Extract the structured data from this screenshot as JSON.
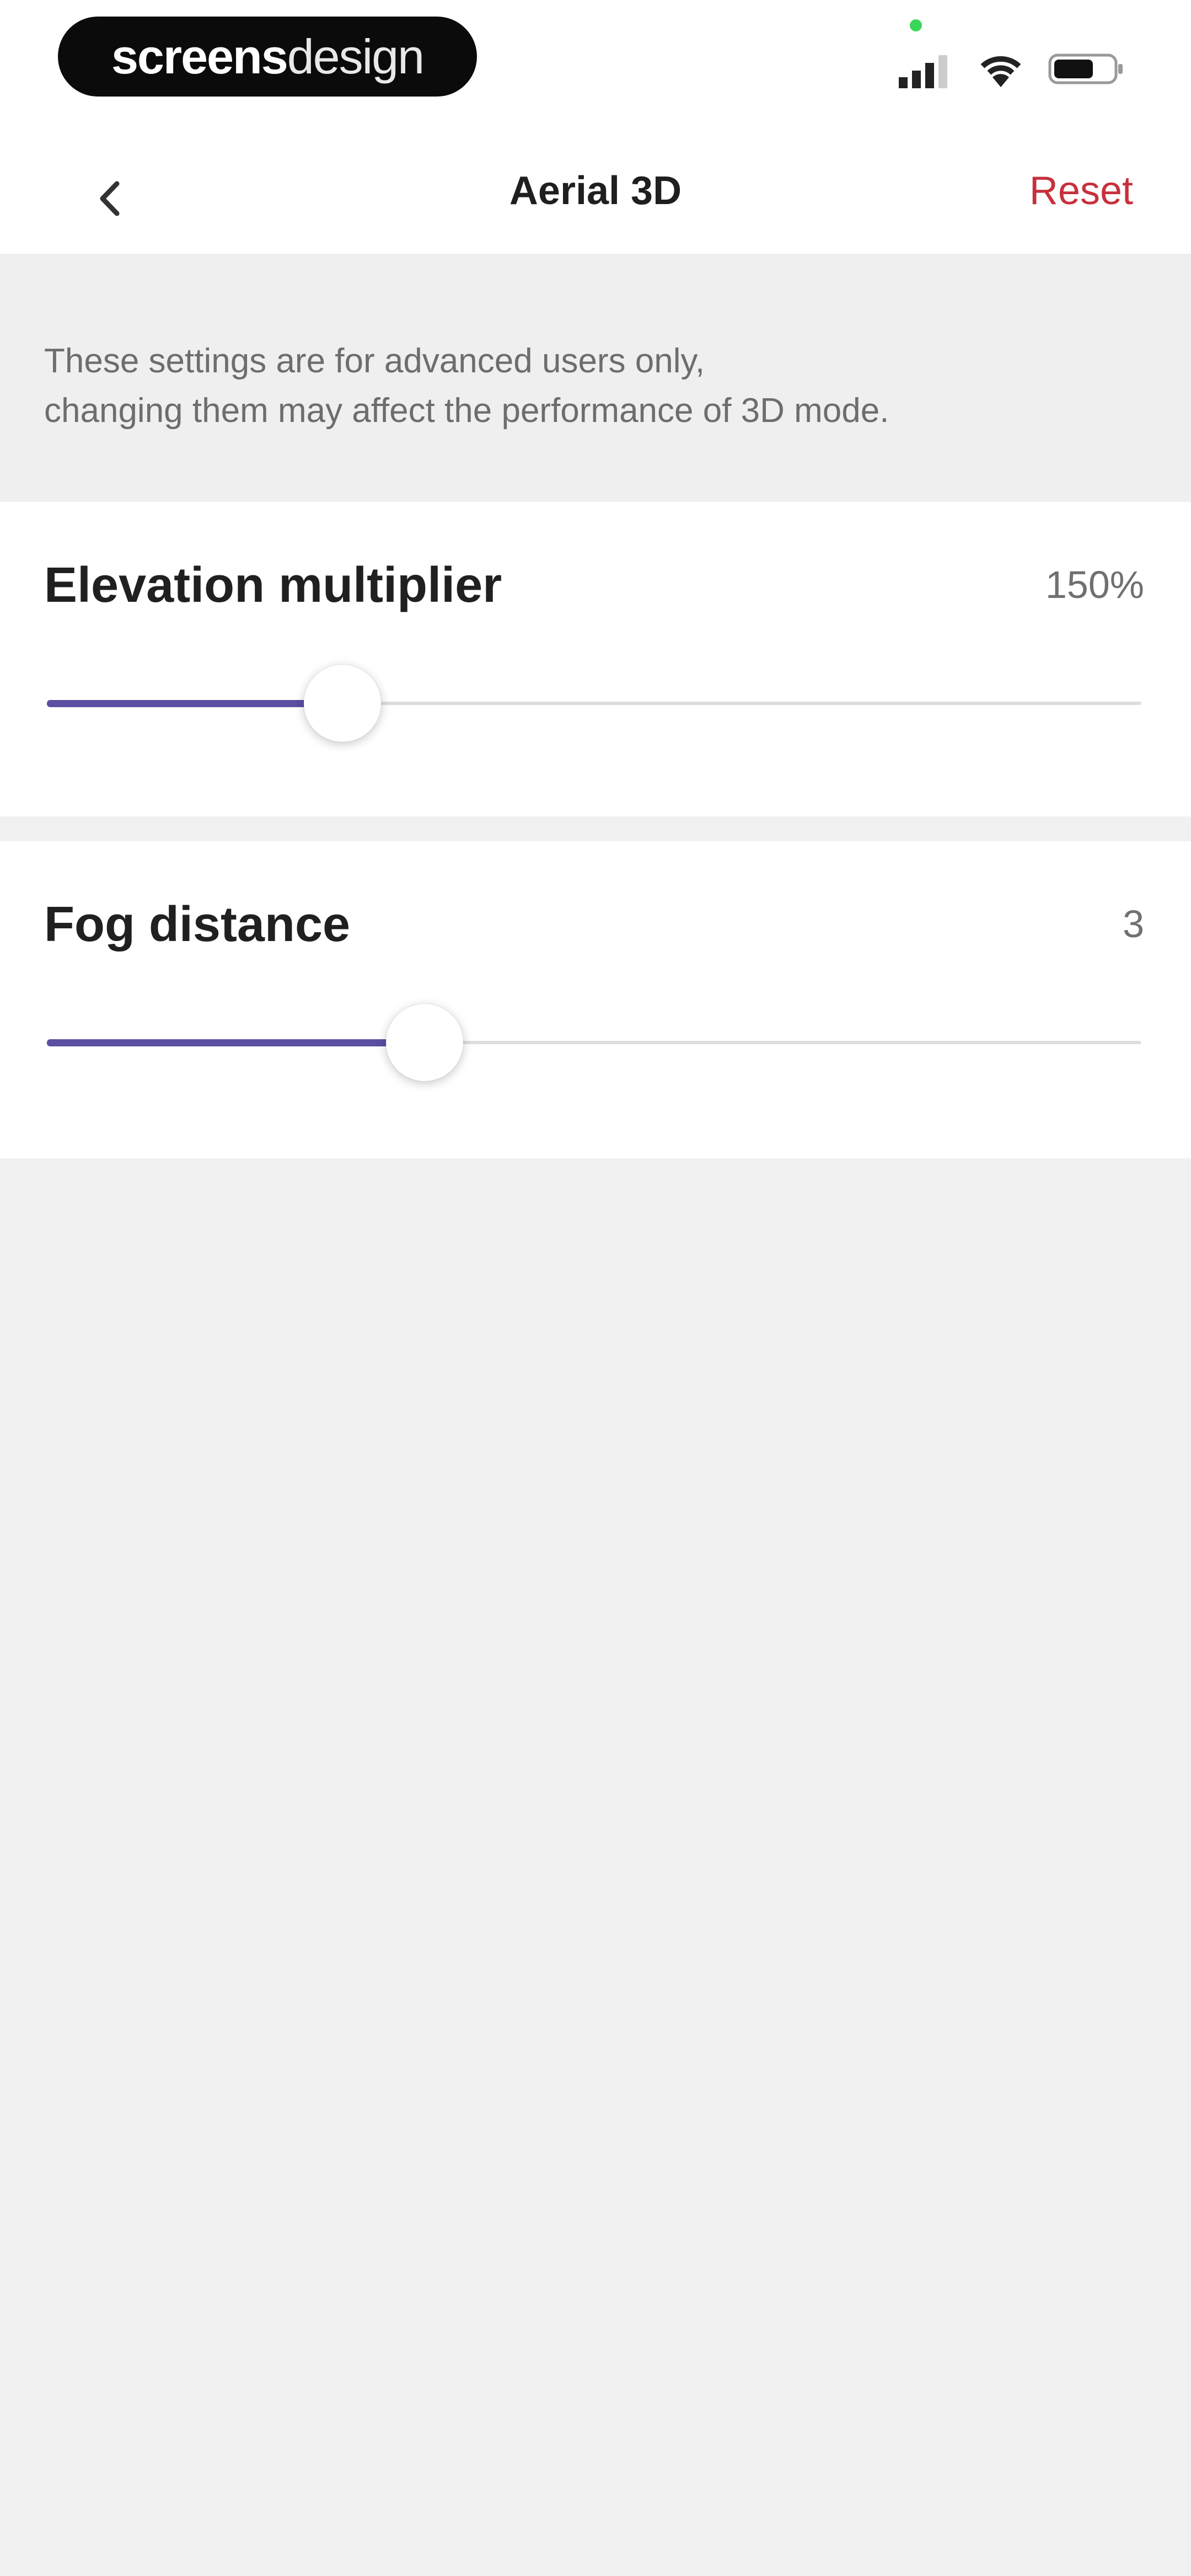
{
  "status_bar": {
    "brand_bold": "screens",
    "brand_light": "design",
    "icons": [
      "signal-icon",
      "wifi-icon",
      "battery-icon"
    ]
  },
  "nav": {
    "back_icon": "chevron-left-icon",
    "title": "Aerial 3D",
    "reset_label": "Reset"
  },
  "notice": {
    "line1": "These settings are for advanced users only,",
    "line2": "changing them may affect the performance of 3D mode."
  },
  "settings": {
    "elevation": {
      "label": "Elevation multiplier",
      "value": "150%",
      "slider_fraction": 0.27
    },
    "fog": {
      "label": "Fog distance",
      "value": "3",
      "slider_fraction": 0.345
    }
  },
  "colors": {
    "accent": "#5a4fa2",
    "reset": "#c7303b",
    "background": "#f1f1f1"
  }
}
